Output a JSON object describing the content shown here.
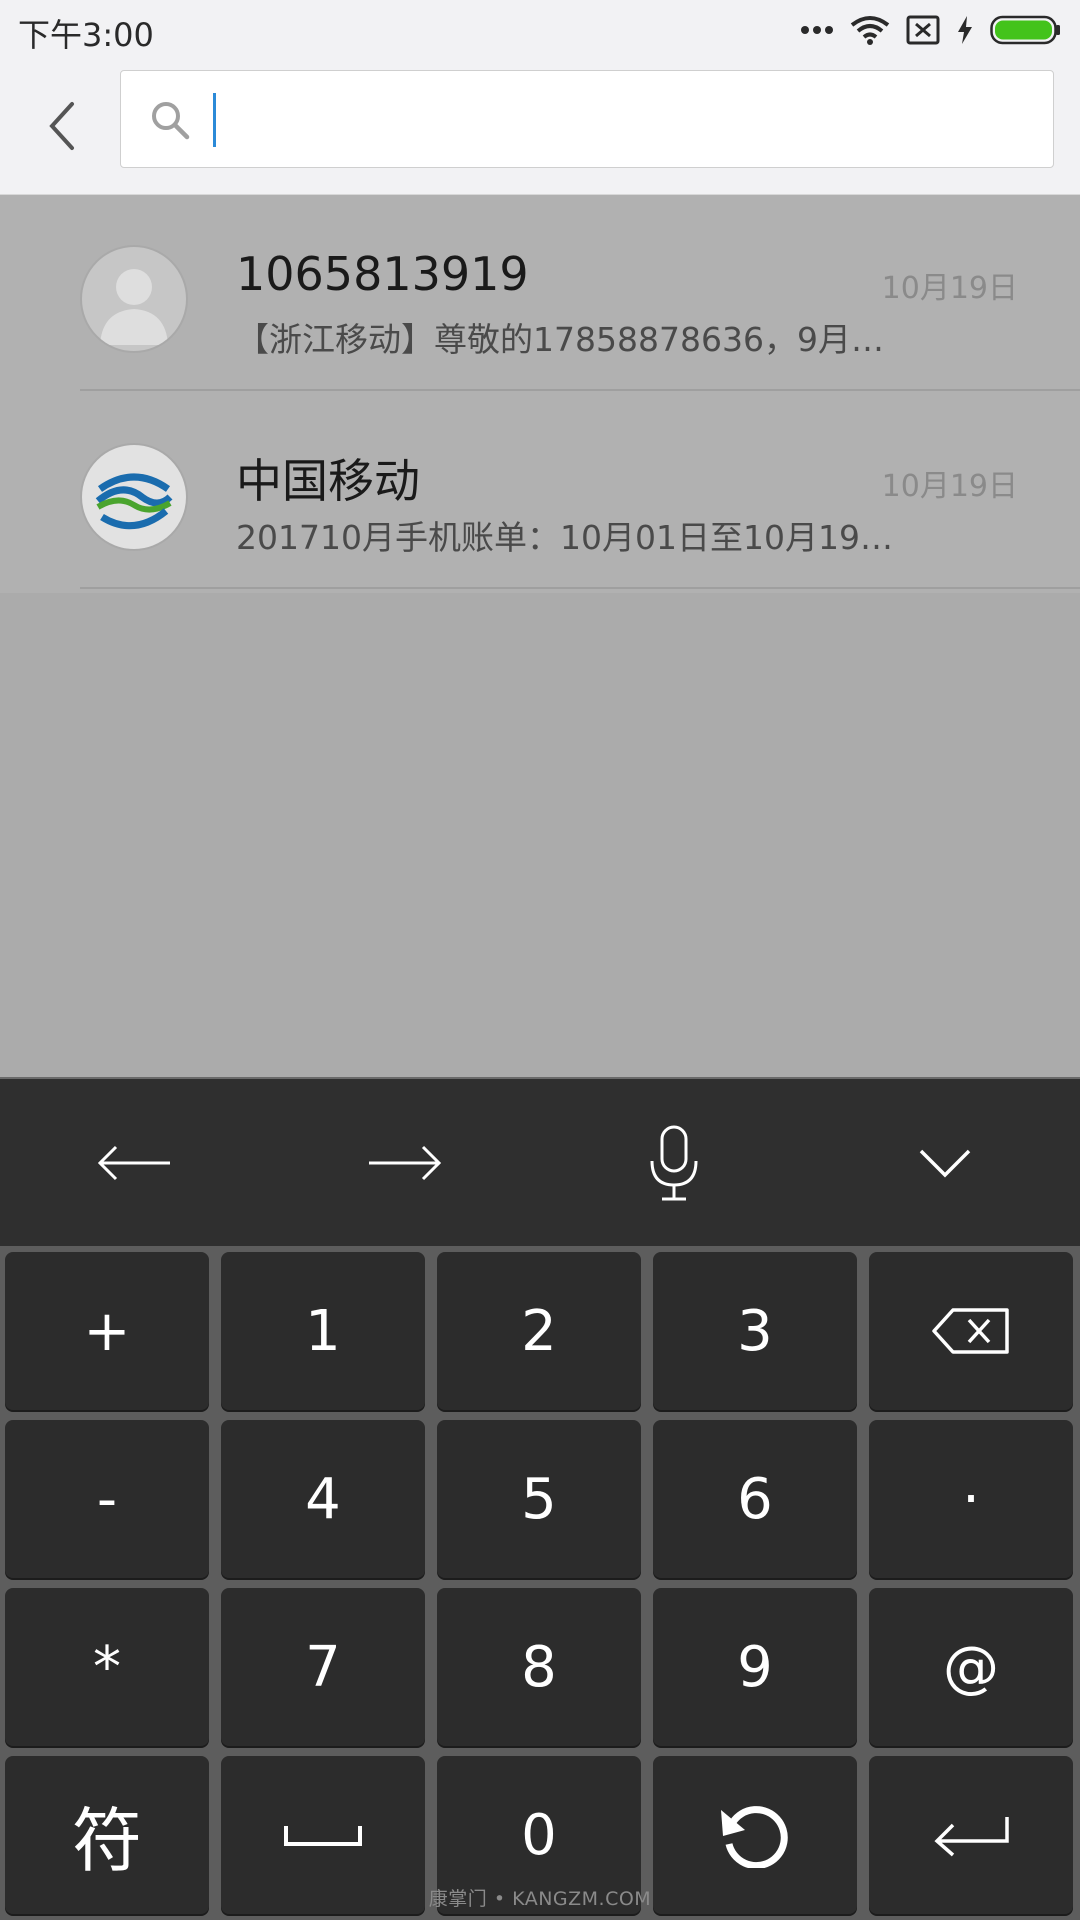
{
  "status_bar": {
    "time": "下午3:00"
  },
  "search": {
    "placeholder": "",
    "value": ""
  },
  "results": [
    {
      "name": "1065813919",
      "snippet": "【浙江移动】尊敬的17858878636，9月…",
      "date": "10月19日",
      "avatar": "person-icon"
    },
    {
      "name": "中国移动",
      "snippet": "201710月手机账单：10月01日至10月19…",
      "date": "10月19日",
      "avatar": "china-mobile-logo"
    }
  ],
  "keyboard": {
    "toolbar": [
      "arrow-left-icon",
      "arrow-right-icon",
      "microphone-icon",
      "collapse-icon"
    ],
    "keys": {
      "plus": "+",
      "k1": "1",
      "k2": "2",
      "k3": "3",
      "minus": "-",
      "k4": "4",
      "k5": "5",
      "k6": "6",
      "dot": "·",
      "star": "*",
      "k7": "7",
      "k8": "8",
      "k9": "9",
      "at": "@",
      "symbols": "符",
      "k0": "0"
    }
  },
  "watermark": "康掌门 • KANGZM.COM",
  "colors": {
    "accent": "#2b8ad8",
    "battery": "#43c31b"
  }
}
